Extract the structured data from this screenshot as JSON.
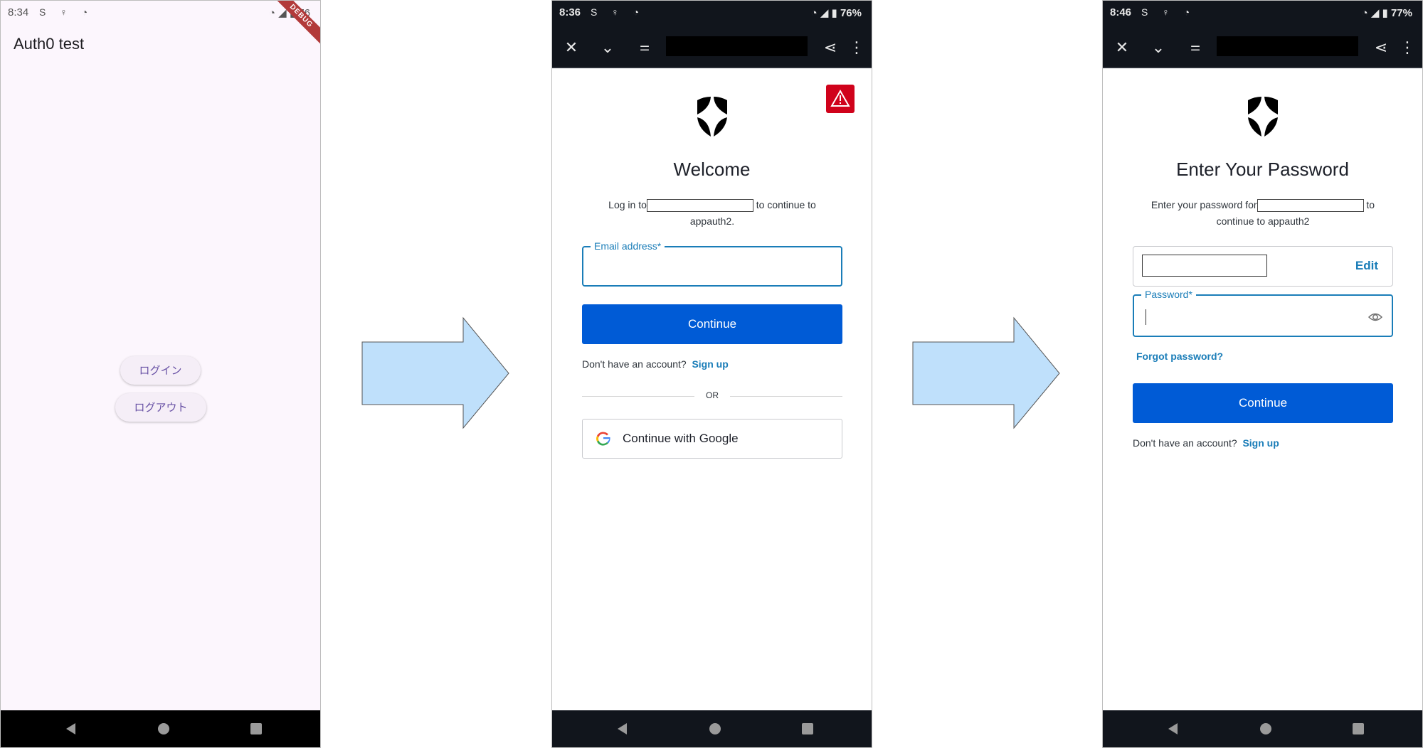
{
  "screens": [
    {
      "status": {
        "time": "8:34",
        "battery": "76"
      },
      "debug_ribbon": "DEBUG",
      "app_title": "Auth0 test",
      "buttons": {
        "login": "ログイン",
        "logout": "ログアウト"
      }
    },
    {
      "status": {
        "time": "8:36",
        "battery": "76%"
      },
      "toolbar": {
        "close_icon": "close-icon",
        "collapse_icon": "chevron-down-icon",
        "settings_icon": "tune-icon",
        "share_icon": "share-icon",
        "menu_icon": "more-vert-icon"
      },
      "title": "Welcome",
      "subtitle_prefix": "Log in to",
      "subtitle_suffix": "to continue to",
      "subtitle_app": "appauth2.",
      "email_label": "Email address*",
      "email_value": "",
      "continue_label": "Continue",
      "no_account": "Don't have an account?",
      "signup_label": "Sign up",
      "or_label": "OR",
      "google_label": "Continue with Google"
    },
    {
      "status": {
        "time": "8:46",
        "battery": "77%"
      },
      "title": "Enter Your Password",
      "subtitle_prefix": "Enter your password for",
      "subtitle_suffix": "to",
      "subtitle_line2": "continue to appauth2",
      "edit_label": "Edit",
      "password_label": "Password*",
      "password_value": "",
      "forgot_label": "Forgot password?",
      "continue_label": "Continue",
      "no_account": "Don't have an account?",
      "signup_label": "Sign up"
    }
  ],
  "colors": {
    "primary_button": "#005bd6",
    "link": "#1a7db8",
    "warning": "#d0021b",
    "arrow_fill": "#bfe0fb",
    "app_background": "#fcf6fd",
    "app_button_text": "#6750a4"
  }
}
